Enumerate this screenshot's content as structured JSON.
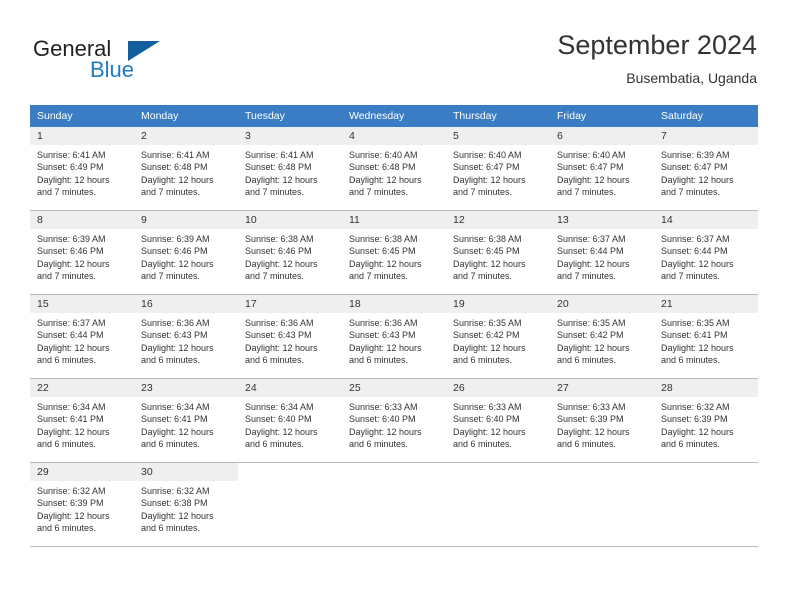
{
  "brand": {
    "name_part1": "General",
    "name_part2": "Blue",
    "logo_icon": "triangle-flag-icon",
    "accent_color": "#1e7bc4"
  },
  "header": {
    "title": "September 2024",
    "subtitle": "Busembatia, Uganda"
  },
  "calendar": {
    "header_bg": "#3b7dc4",
    "daynum_bg": "#efefef",
    "weekdays": [
      "Sunday",
      "Monday",
      "Tuesday",
      "Wednesday",
      "Thursday",
      "Friday",
      "Saturday"
    ],
    "weeks": [
      [
        {
          "day": "1",
          "sunrise": "Sunrise: 6:41 AM",
          "sunset": "Sunset: 6:49 PM",
          "daylight_line1": "Daylight: 12 hours",
          "daylight_line2": "and 7 minutes."
        },
        {
          "day": "2",
          "sunrise": "Sunrise: 6:41 AM",
          "sunset": "Sunset: 6:48 PM",
          "daylight_line1": "Daylight: 12 hours",
          "daylight_line2": "and 7 minutes."
        },
        {
          "day": "3",
          "sunrise": "Sunrise: 6:41 AM",
          "sunset": "Sunset: 6:48 PM",
          "daylight_line1": "Daylight: 12 hours",
          "daylight_line2": "and 7 minutes."
        },
        {
          "day": "4",
          "sunrise": "Sunrise: 6:40 AM",
          "sunset": "Sunset: 6:48 PM",
          "daylight_line1": "Daylight: 12 hours",
          "daylight_line2": "and 7 minutes."
        },
        {
          "day": "5",
          "sunrise": "Sunrise: 6:40 AM",
          "sunset": "Sunset: 6:47 PM",
          "daylight_line1": "Daylight: 12 hours",
          "daylight_line2": "and 7 minutes."
        },
        {
          "day": "6",
          "sunrise": "Sunrise: 6:40 AM",
          "sunset": "Sunset: 6:47 PM",
          "daylight_line1": "Daylight: 12 hours",
          "daylight_line2": "and 7 minutes."
        },
        {
          "day": "7",
          "sunrise": "Sunrise: 6:39 AM",
          "sunset": "Sunset: 6:47 PM",
          "daylight_line1": "Daylight: 12 hours",
          "daylight_line2": "and 7 minutes."
        }
      ],
      [
        {
          "day": "8",
          "sunrise": "Sunrise: 6:39 AM",
          "sunset": "Sunset: 6:46 PM",
          "daylight_line1": "Daylight: 12 hours",
          "daylight_line2": "and 7 minutes."
        },
        {
          "day": "9",
          "sunrise": "Sunrise: 6:39 AM",
          "sunset": "Sunset: 6:46 PM",
          "daylight_line1": "Daylight: 12 hours",
          "daylight_line2": "and 7 minutes."
        },
        {
          "day": "10",
          "sunrise": "Sunrise: 6:38 AM",
          "sunset": "Sunset: 6:46 PM",
          "daylight_line1": "Daylight: 12 hours",
          "daylight_line2": "and 7 minutes."
        },
        {
          "day": "11",
          "sunrise": "Sunrise: 6:38 AM",
          "sunset": "Sunset: 6:45 PM",
          "daylight_line1": "Daylight: 12 hours",
          "daylight_line2": "and 7 minutes."
        },
        {
          "day": "12",
          "sunrise": "Sunrise: 6:38 AM",
          "sunset": "Sunset: 6:45 PM",
          "daylight_line1": "Daylight: 12 hours",
          "daylight_line2": "and 7 minutes."
        },
        {
          "day": "13",
          "sunrise": "Sunrise: 6:37 AM",
          "sunset": "Sunset: 6:44 PM",
          "daylight_line1": "Daylight: 12 hours",
          "daylight_line2": "and 7 minutes."
        },
        {
          "day": "14",
          "sunrise": "Sunrise: 6:37 AM",
          "sunset": "Sunset: 6:44 PM",
          "daylight_line1": "Daylight: 12 hours",
          "daylight_line2": "and 7 minutes."
        }
      ],
      [
        {
          "day": "15",
          "sunrise": "Sunrise: 6:37 AM",
          "sunset": "Sunset: 6:44 PM",
          "daylight_line1": "Daylight: 12 hours",
          "daylight_line2": "and 6 minutes."
        },
        {
          "day": "16",
          "sunrise": "Sunrise: 6:36 AM",
          "sunset": "Sunset: 6:43 PM",
          "daylight_line1": "Daylight: 12 hours",
          "daylight_line2": "and 6 minutes."
        },
        {
          "day": "17",
          "sunrise": "Sunrise: 6:36 AM",
          "sunset": "Sunset: 6:43 PM",
          "daylight_line1": "Daylight: 12 hours",
          "daylight_line2": "and 6 minutes."
        },
        {
          "day": "18",
          "sunrise": "Sunrise: 6:36 AM",
          "sunset": "Sunset: 6:43 PM",
          "daylight_line1": "Daylight: 12 hours",
          "daylight_line2": "and 6 minutes."
        },
        {
          "day": "19",
          "sunrise": "Sunrise: 6:35 AM",
          "sunset": "Sunset: 6:42 PM",
          "daylight_line1": "Daylight: 12 hours",
          "daylight_line2": "and 6 minutes."
        },
        {
          "day": "20",
          "sunrise": "Sunrise: 6:35 AM",
          "sunset": "Sunset: 6:42 PM",
          "daylight_line1": "Daylight: 12 hours",
          "daylight_line2": "and 6 minutes."
        },
        {
          "day": "21",
          "sunrise": "Sunrise: 6:35 AM",
          "sunset": "Sunset: 6:41 PM",
          "daylight_line1": "Daylight: 12 hours",
          "daylight_line2": "and 6 minutes."
        }
      ],
      [
        {
          "day": "22",
          "sunrise": "Sunrise: 6:34 AM",
          "sunset": "Sunset: 6:41 PM",
          "daylight_line1": "Daylight: 12 hours",
          "daylight_line2": "and 6 minutes."
        },
        {
          "day": "23",
          "sunrise": "Sunrise: 6:34 AM",
          "sunset": "Sunset: 6:41 PM",
          "daylight_line1": "Daylight: 12 hours",
          "daylight_line2": "and 6 minutes."
        },
        {
          "day": "24",
          "sunrise": "Sunrise: 6:34 AM",
          "sunset": "Sunset: 6:40 PM",
          "daylight_line1": "Daylight: 12 hours",
          "daylight_line2": "and 6 minutes."
        },
        {
          "day": "25",
          "sunrise": "Sunrise: 6:33 AM",
          "sunset": "Sunset: 6:40 PM",
          "daylight_line1": "Daylight: 12 hours",
          "daylight_line2": "and 6 minutes."
        },
        {
          "day": "26",
          "sunrise": "Sunrise: 6:33 AM",
          "sunset": "Sunset: 6:40 PM",
          "daylight_line1": "Daylight: 12 hours",
          "daylight_line2": "and 6 minutes."
        },
        {
          "day": "27",
          "sunrise": "Sunrise: 6:33 AM",
          "sunset": "Sunset: 6:39 PM",
          "daylight_line1": "Daylight: 12 hours",
          "daylight_line2": "and 6 minutes."
        },
        {
          "day": "28",
          "sunrise": "Sunrise: 6:32 AM",
          "sunset": "Sunset: 6:39 PM",
          "daylight_line1": "Daylight: 12 hours",
          "daylight_line2": "and 6 minutes."
        }
      ],
      [
        {
          "day": "29",
          "sunrise": "Sunrise: 6:32 AM",
          "sunset": "Sunset: 6:39 PM",
          "daylight_line1": "Daylight: 12 hours",
          "daylight_line2": "and 6 minutes."
        },
        {
          "day": "30",
          "sunrise": "Sunrise: 6:32 AM",
          "sunset": "Sunset: 6:38 PM",
          "daylight_line1": "Daylight: 12 hours",
          "daylight_line2": "and 6 minutes."
        },
        null,
        null,
        null,
        null,
        null
      ]
    ]
  }
}
